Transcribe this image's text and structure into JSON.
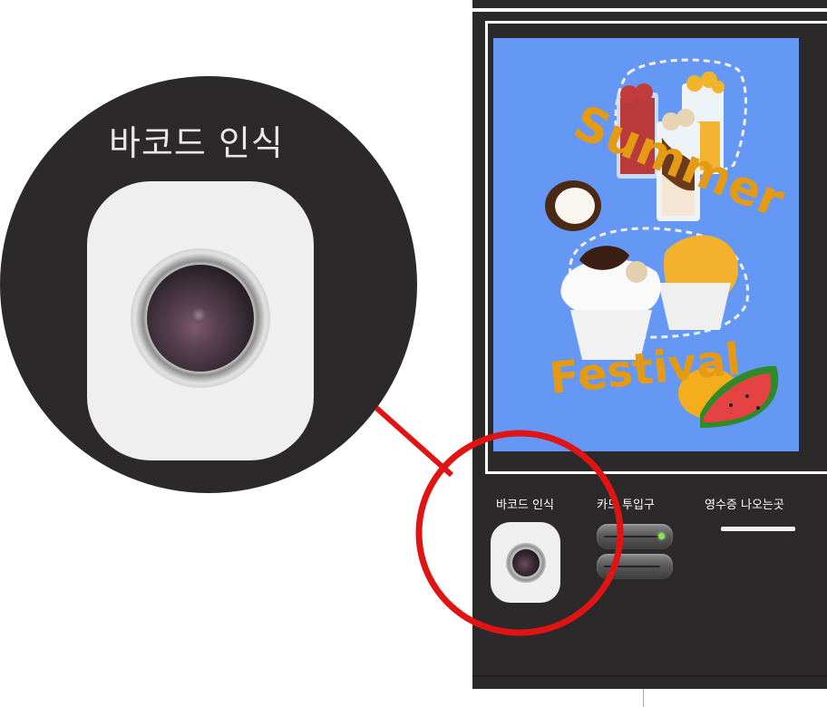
{
  "poster": {
    "title_word_1": "Summer",
    "title_word_2": "Festival"
  },
  "kiosk": {
    "barcode_label": "바코드 인식",
    "card_label": "카드 투입구",
    "receipt_label": "영수증 나오는곳"
  },
  "zoom": {
    "label": "바코드 인식"
  },
  "colors": {
    "kiosk_body": "#2b292a",
    "screen_bg": "#6598f5",
    "highlight_red": "#e11414",
    "poster_text": "#e49a12",
    "card_led": "#8ee05a"
  },
  "icons": [
    "camera-lens-icon"
  ]
}
